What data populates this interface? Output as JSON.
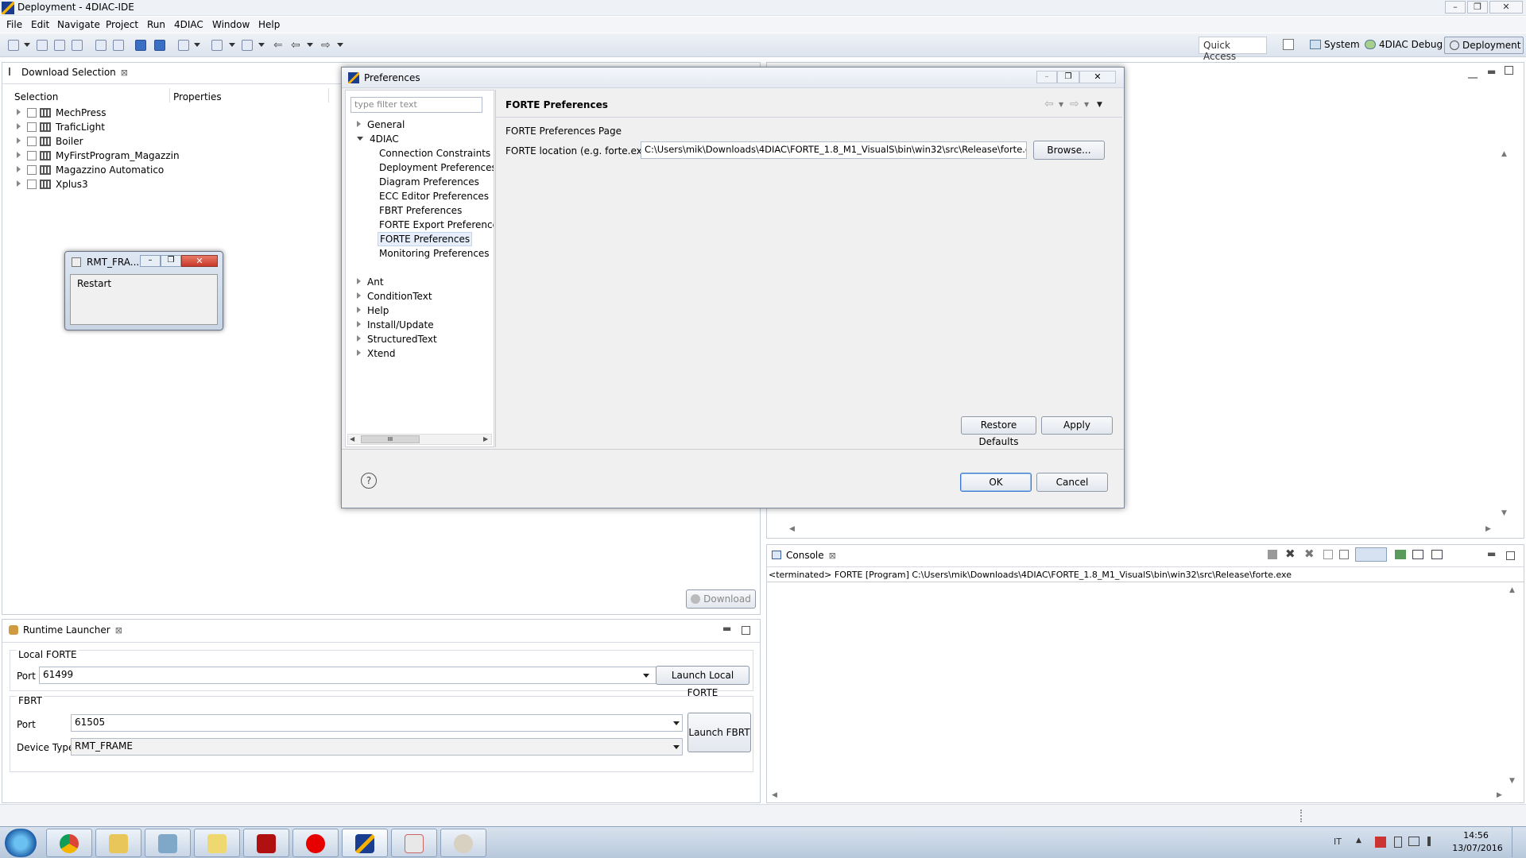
{
  "window": {
    "title": "Deployment - 4DIAC-IDE"
  },
  "menu": [
    "File",
    "Edit",
    "Navigate",
    "Project",
    "Run",
    "4DIAC",
    "Window",
    "Help"
  ],
  "toolbar": {
    "quick_access": "Quick Access"
  },
  "perspectives": {
    "system": "System",
    "debug": "4DIAC Debug",
    "deployment": "Deployment"
  },
  "download_selection": {
    "tab": "Download Selection",
    "col_selection": "Selection",
    "col_properties": "Properties",
    "systems": [
      "MechPress",
      "TraficLight",
      "Boiler",
      "MyFirstProgram_Magazzin",
      "Magazzino Automatico",
      "Xplus3"
    ],
    "download_label": "Download"
  },
  "rmt_frame": {
    "title": "RMT_FRA...",
    "button": "Restart"
  },
  "runtime_launcher": {
    "tab": "Runtime Launcher",
    "local_group": "Local FORTE",
    "port_label": "Port",
    "local_port": "61499",
    "launch_local": "Launch Local FORTE",
    "fbrt_group": "FBRT",
    "fbrt_port": "61505",
    "device_type_label": "Device Type",
    "device_type": "RMT_FRAME",
    "launch_fbrt": "Launch FBRT"
  },
  "console": {
    "tab": "Console",
    "line": "<terminated> FORTE [Program] C:\\Users\\mik\\Downloads\\4DIAC\\FORTE_1.8_M1_VisualS\\bin\\win32\\src\\Release\\forte.exe"
  },
  "preferences": {
    "title": "Preferences",
    "filter_placeholder": "type filter text",
    "tree": {
      "general": "General",
      "diac": "4DIAC",
      "diac_children": [
        "Connection Constraints",
        "Deployment Preferences",
        "Diagram Preferences",
        "ECC Editor Preferences",
        "FBRT Preferences",
        "FORTE Export Preferences",
        "FORTE Preferences",
        "Monitoring Preferences"
      ],
      "others": [
        "Ant",
        "ConditionText",
        "Help",
        "Install/Update",
        "StructuredText",
        "Xtend"
      ]
    },
    "page_title": "FORTE Preferences",
    "page_desc": "FORTE Preferences Page",
    "location_label": "FORTE location (e.g. forte.exe):",
    "location_value": "C:\\Users\\mik\\Downloads\\4DIAC\\FORTE_1.8_M1_VisualS\\bin\\win32\\src\\Release\\forte.exe",
    "browse": "Browse...",
    "restore_defaults": "Restore Defaults",
    "apply": "Apply",
    "ok": "OK",
    "cancel": "Cancel",
    "scroll_grip": "III"
  },
  "taskbar": {
    "lang": "IT",
    "time": "14:56",
    "date": "13/07/2016"
  }
}
